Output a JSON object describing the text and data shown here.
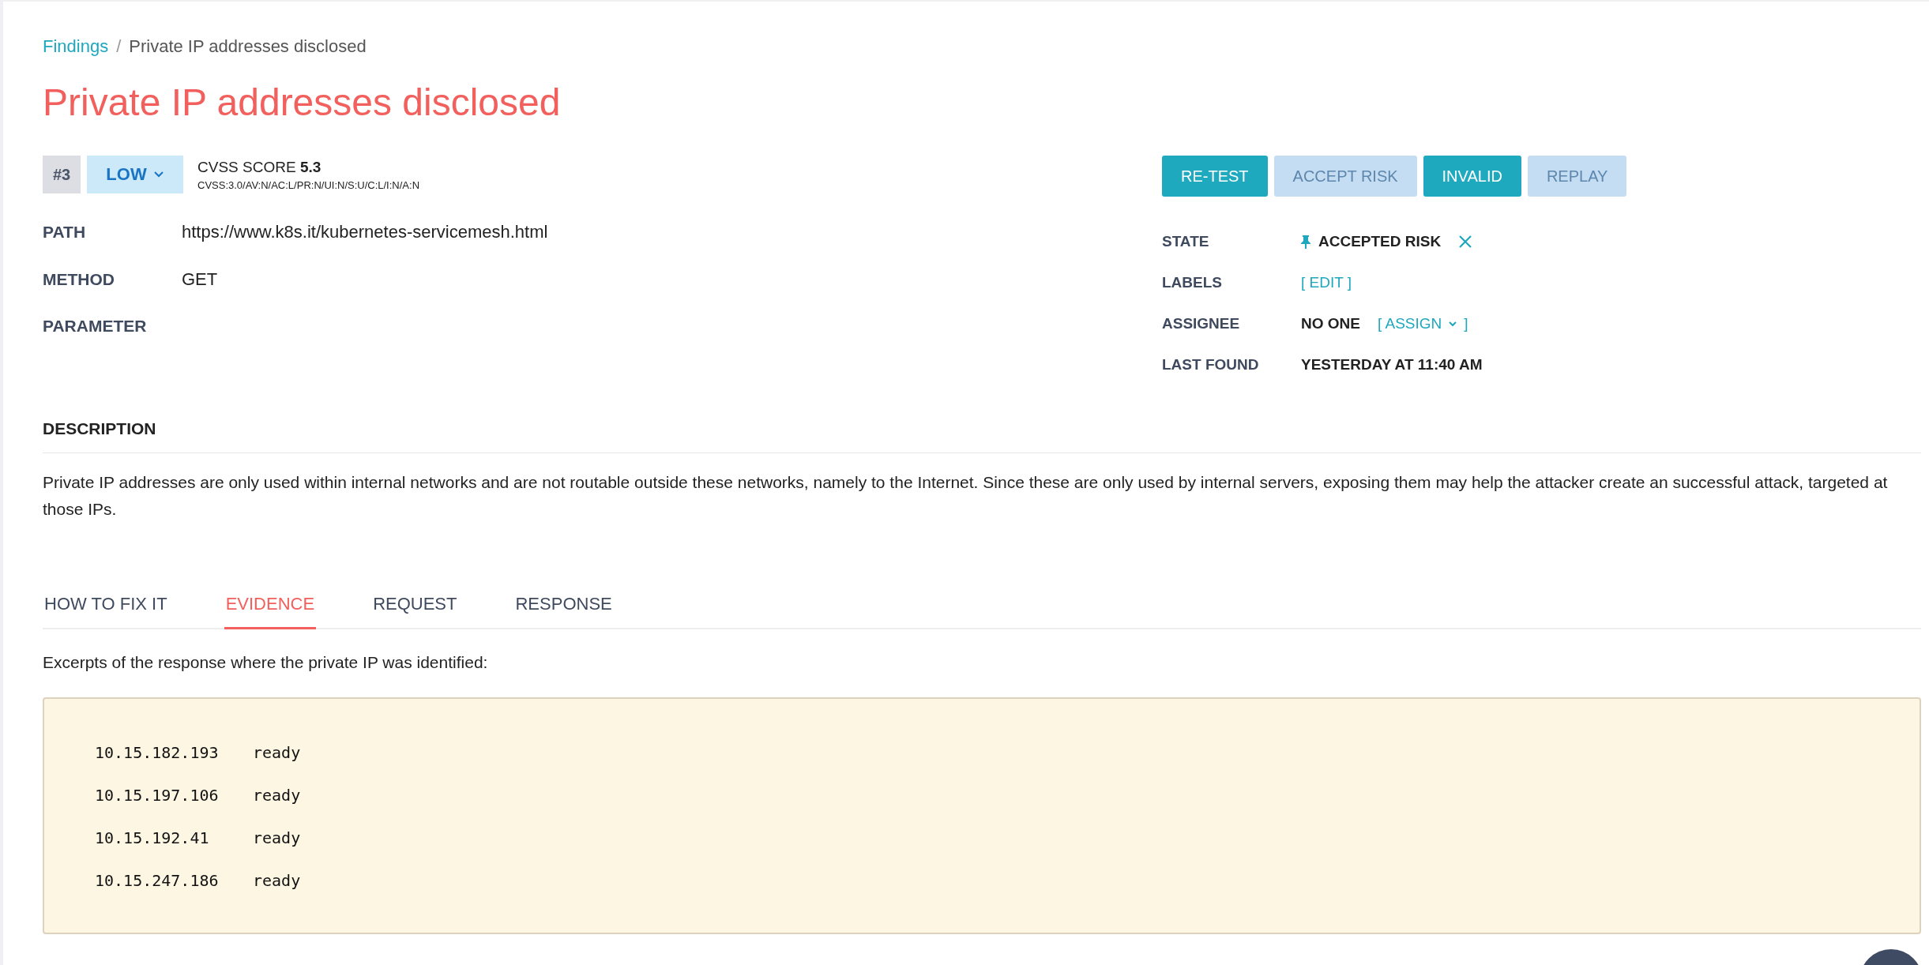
{
  "breadcrumb": [
    {
      "label": "Findings",
      "link": true
    },
    {
      "label": "Private IP addresses disclosed",
      "link": false
    }
  ],
  "breadcrumb_separator": "/",
  "title": "Private IP addresses disclosed",
  "finding_number": "#3",
  "severity": {
    "label": "LOW"
  },
  "cvss": {
    "label": "CVSS SCORE",
    "score": "5.3",
    "vector": "CVSS:3.0/AV:N/AC:L/PR:N/UI:N/S:U/C:L/I:N/A:N"
  },
  "actions": [
    {
      "label": "RE-TEST",
      "disabled": false
    },
    {
      "label": "ACCEPT RISK",
      "disabled": true
    },
    {
      "label": "INVALID",
      "disabled": false
    },
    {
      "label": "REPLAY",
      "disabled": true
    }
  ],
  "details": [
    {
      "label": "PATH",
      "value": "https://www.k8s.it/kubernetes-servicemesh.html"
    },
    {
      "label": "METHOD",
      "value": "GET"
    },
    {
      "label": "PARAMETER"
    }
  ],
  "meta": [
    {
      "kind": "state",
      "label": "STATE",
      "value": "ACCEPTED RISK"
    },
    {
      "kind": "link",
      "label": "LABELS",
      "link": "[ EDIT ]"
    },
    {
      "kind": "assign",
      "label": "ASSIGNEE",
      "value": "NO ONE",
      "link": "[ ASSIGN",
      "link_end": "]"
    },
    {
      "kind": "text",
      "label": "LAST FOUND",
      "value": "YESTERDAY AT 11:40 AM"
    }
  ],
  "description": {
    "heading": "DESCRIPTION",
    "text": "Private IP addresses are only used within internal networks and are not routable outside these networks, namely to the Internet. Since these are only used by internal servers, exposing them may help the attacker create an successful attack, targeted at those IPs."
  },
  "tabs": [
    {
      "label": "HOW TO FIX IT",
      "selected": false
    },
    {
      "label": "EVIDENCE",
      "selected": true
    },
    {
      "label": "REQUEST",
      "selected": false
    },
    {
      "label": "RESPONSE",
      "selected": false
    }
  ],
  "evidence": {
    "intro": "Excerpts of the response where the private IP was identified:",
    "lines": [
      {
        "ip": "10.15.182.193",
        "status": "ready"
      },
      {
        "ip": "10.15.197.106",
        "status": "ready"
      },
      {
        "ip": "10.15.192.41",
        "status": "ready"
      },
      {
        "ip": "10.15.247.186",
        "status": "ready"
      }
    ]
  }
}
